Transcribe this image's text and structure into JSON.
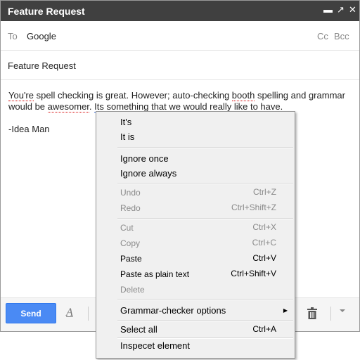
{
  "window": {
    "title": "Feature Request",
    "controls": {
      "minimize": "▬",
      "popout": "↗",
      "close": "✕"
    }
  },
  "recipients": {
    "to_label": "To",
    "to_value": "Google",
    "cc_label": "Cc",
    "bcc_label": "Bcc"
  },
  "subject": "Feature Request",
  "body": {
    "w1": "You're",
    "t1": " spell checking is great. However; auto-checking ",
    "w2": "booth",
    "t2": " spelling and grammar would be ",
    "w3": "awesomer",
    "t3": ". ",
    "w4": "Its",
    "t4": " something that we would really like to have.",
    "signature": "-Idea Man"
  },
  "toolbar": {
    "send_label": "Send",
    "format_icon": "A",
    "icons": [
      "format-text-icon",
      "trash-icon",
      "more-options-icon"
    ]
  },
  "context_menu": {
    "suggestions": [
      "It's",
      "It is"
    ],
    "ignore_once": "Ignore once",
    "ignore_always": "Ignore always",
    "undo": {
      "label": "Undo",
      "shortcut": "Ctrl+Z"
    },
    "redo": {
      "label": "Redo",
      "shortcut": "Ctrl+Shift+Z"
    },
    "cut": {
      "label": "Cut",
      "shortcut": "Ctrl+X"
    },
    "copy": {
      "label": "Copy",
      "shortcut": "Ctrl+C"
    },
    "paste": {
      "label": "Paste",
      "shortcut": "Ctrl+V"
    },
    "paste_plain": {
      "label": "Paste as plain text",
      "shortcut": "Ctrl+Shift+V"
    },
    "delete": {
      "label": "Delete"
    },
    "grammar_options": {
      "label": "Grammar-checker options",
      "arrow": "▶"
    },
    "select_all": {
      "label": "Select all",
      "shortcut": "Ctrl+A"
    },
    "inspect": {
      "label": "Inspecet element"
    }
  },
  "colors": {
    "titlebar": "#404040",
    "send_button": "#4a8af4",
    "spell_error": "#d40000",
    "grammar_error": "#3366cc",
    "menu_bg": "#f0f0f0"
  }
}
